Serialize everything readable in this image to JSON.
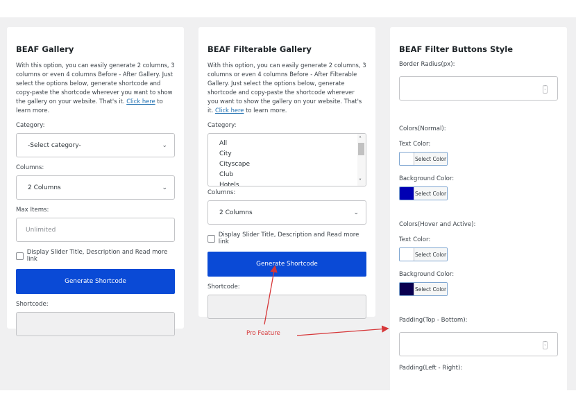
{
  "gallery": {
    "title": "BEAF Gallery",
    "desc": "With this option, you can easily generate 2 columns, 3 columns or even 4 columns Before - After Gallery. Just select the options below, generate shortcode and copy-paste the shortcode wherever you want to show the gallery on your website. That's it.",
    "link": "Click here",
    "desc_end": " to learn more.",
    "category_label": "Category:",
    "category_value": "-Select category-",
    "columns_label": "Columns:",
    "columns_value": "2 Columns",
    "max_label": "Max Items:",
    "max_placeholder": "Unlimited",
    "checkbox": "Display Slider Title, Description and Read more link",
    "button": "Generate Shortcode",
    "shortcode_label": "Shortcode:"
  },
  "filterable": {
    "title": "BEAF Filterable Gallery",
    "desc": "With this option, you can easily generate 2 columns, 3 columns or even 4 columns Before - After Filterable Gallery. Just select the options below, generate shortcode and copy-paste the shortcode wherever you want to show the gallery on your website. That's it.",
    "link": "Click here",
    "desc_end": " to learn more.",
    "category_label": "Category:",
    "categories": [
      "All",
      "City",
      "Cityscape",
      "Club",
      "Hotels"
    ],
    "columns_label": "Columns:",
    "columns_value": "2 Columns",
    "checkbox": "Display Slider Title, Description and Read more link",
    "button": "Generate Shortcode",
    "shortcode_label": "Shortcode:"
  },
  "filter_style": {
    "title": "BEAF Filter Buttons Style",
    "border_radius": "Border Radius(px):",
    "normal": "Colors(Normal):",
    "hover": "Colors(Hover and Active):",
    "text_color": "Text Color:",
    "bg_color": "Background Color:",
    "select_color": "Select Color",
    "normal_text": "#ffffff",
    "normal_bg": "#0000b3",
    "hover_text": "#ffffff",
    "hover_bg": "#0a0050",
    "padding_tb": "Padding(Top - Bottom):",
    "padding_lr": "Padding(Left - Right):"
  },
  "annotation": {
    "text": "Pro Feature",
    "color": "#d63638"
  }
}
